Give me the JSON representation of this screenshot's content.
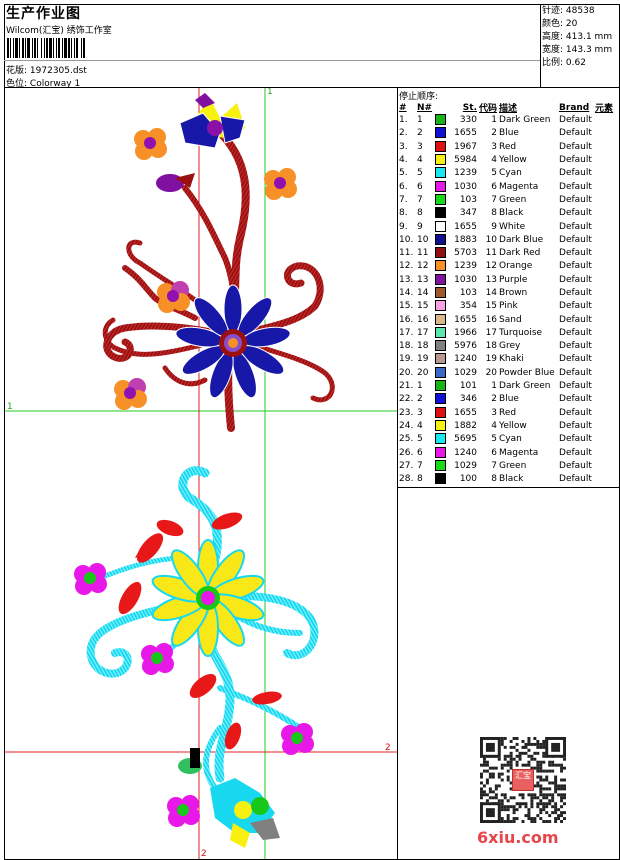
{
  "header": {
    "title": "生产作业图",
    "company": "Wilcom(汇宝) 绣饰工作室",
    "design_label": "花版:",
    "design_value": "1972305.dst",
    "colorway_label": "色位:",
    "colorway_value": "Colorway 1"
  },
  "stats": [
    {
      "label": "针迹:",
      "value": "48538"
    },
    {
      "label": "颜色:",
      "value": "20"
    },
    {
      "label": "高度:",
      "value": "413.1 mm"
    },
    {
      "label": "宽度:",
      "value": "143.3 mm"
    },
    {
      "label": "比例:",
      "value": "0.62"
    }
  ],
  "stop_sequence_title": "停止顺序:",
  "table_headers": {
    "idx": "#",
    "n": "N#",
    "st": "St.",
    "code": "代码",
    "desc": "描述",
    "brand": "Brand",
    "elem": "元素"
  },
  "rows": [
    {
      "idx": "1.",
      "n": "1",
      "color": "#16b417",
      "st": "330",
      "code": "1",
      "desc": "Dark Green",
      "brand": "Default"
    },
    {
      "idx": "2.",
      "n": "2",
      "color": "#1010d8",
      "st": "1655",
      "code": "2",
      "desc": "Blue",
      "brand": "Default"
    },
    {
      "idx": "3.",
      "n": "3",
      "color": "#e01010",
      "st": "1967",
      "code": "3",
      "desc": "Red",
      "brand": "Default"
    },
    {
      "idx": "4.",
      "n": "4",
      "color": "#f8f010",
      "st": "5984",
      "code": "4",
      "desc": "Yellow",
      "brand": "Default"
    },
    {
      "idx": "5.",
      "n": "5",
      "color": "#18e8f0",
      "st": "1239",
      "code": "5",
      "desc": "Cyan",
      "brand": "Default"
    },
    {
      "idx": "6.",
      "n": "6",
      "color": "#e818e8",
      "st": "1030",
      "code": "6",
      "desc": "Magenta",
      "brand": "Default"
    },
    {
      "idx": "7.",
      "n": "7",
      "color": "#18d818",
      "st": "103",
      "code": "7",
      "desc": "Green",
      "brand": "Default"
    },
    {
      "idx": "8.",
      "n": "8",
      "color": "#000000",
      "st": "347",
      "code": "8",
      "desc": "Black",
      "brand": "Default"
    },
    {
      "idx": "9.",
      "n": "9",
      "color": "#ffffff",
      "st": "1655",
      "code": "9",
      "desc": "White",
      "brand": "Default"
    },
    {
      "idx": "10.",
      "n": "10",
      "color": "#101090",
      "st": "1883",
      "code": "10",
      "desc": "Dark Blue",
      "brand": "Default"
    },
    {
      "idx": "11.",
      "n": "11",
      "color": "#901010",
      "st": "5703",
      "code": "11",
      "desc": "Dark Red",
      "brand": "Default"
    },
    {
      "idx": "12.",
      "n": "12",
      "color": "#f89028",
      "st": "1239",
      "code": "12",
      "desc": "Orange",
      "brand": "Default"
    },
    {
      "idx": "13.",
      "n": "13",
      "color": "#8010a0",
      "st": "1030",
      "code": "13",
      "desc": "Purple",
      "brand": "Default"
    },
    {
      "idx": "14.",
      "n": "14",
      "color": "#a05828",
      "st": "103",
      "code": "14",
      "desc": "Brown",
      "brand": "Default"
    },
    {
      "idx": "15.",
      "n": "15",
      "color": "#f8a0e0",
      "st": "354",
      "code": "15",
      "desc": "Pink",
      "brand": "Default"
    },
    {
      "idx": "16.",
      "n": "16",
      "color": "#d8b888",
      "st": "1655",
      "code": "16",
      "desc": "Sand",
      "brand": "Default"
    },
    {
      "idx": "17.",
      "n": "17",
      "color": "#58e8b0",
      "st": "1966",
      "code": "17",
      "desc": "Turquoise",
      "brand": "Default"
    },
    {
      "idx": "18.",
      "n": "18",
      "color": "#808080",
      "st": "5976",
      "code": "18",
      "desc": "Grey",
      "brand": "Default"
    },
    {
      "idx": "19.",
      "n": "19",
      "color": "#b89890",
      "st": "1240",
      "code": "19",
      "desc": "Khaki",
      "brand": "Default"
    },
    {
      "idx": "20.",
      "n": "20",
      "color": "#3868c8",
      "st": "1029",
      "code": "20",
      "desc": "Powder Blue",
      "brand": "Default"
    },
    {
      "idx": "21.",
      "n": "1",
      "color": "#16b417",
      "st": "101",
      "code": "1",
      "desc": "Dark Green",
      "brand": "Default"
    },
    {
      "idx": "22.",
      "n": "2",
      "color": "#1010d8",
      "st": "346",
      "code": "2",
      "desc": "Blue",
      "brand": "Default"
    },
    {
      "idx": "23.",
      "n": "3",
      "color": "#e01010",
      "st": "1655",
      "code": "3",
      "desc": "Red",
      "brand": "Default"
    },
    {
      "idx": "24.",
      "n": "4",
      "color": "#f8f010",
      "st": "1882",
      "code": "4",
      "desc": "Yellow",
      "brand": "Default"
    },
    {
      "idx": "25.",
      "n": "5",
      "color": "#18e8f0",
      "st": "5695",
      "code": "5",
      "desc": "Cyan",
      "brand": "Default"
    },
    {
      "idx": "26.",
      "n": "6",
      "color": "#e818e8",
      "st": "1240",
      "code": "6",
      "desc": "Magenta",
      "brand": "Default"
    },
    {
      "idx": "27.",
      "n": "7",
      "color": "#18d818",
      "st": "1029",
      "code": "7",
      "desc": "Green",
      "brand": "Default"
    },
    {
      "idx": "28.",
      "n": "8",
      "color": "#000000",
      "st": "100",
      "code": "8",
      "desc": "Black",
      "brand": "Default"
    }
  ],
  "guides": {
    "v1": "1",
    "h1": "1",
    "h2": "2",
    "v2": "2"
  },
  "watermark": "6xiu.com",
  "seal_text": "汇宝"
}
